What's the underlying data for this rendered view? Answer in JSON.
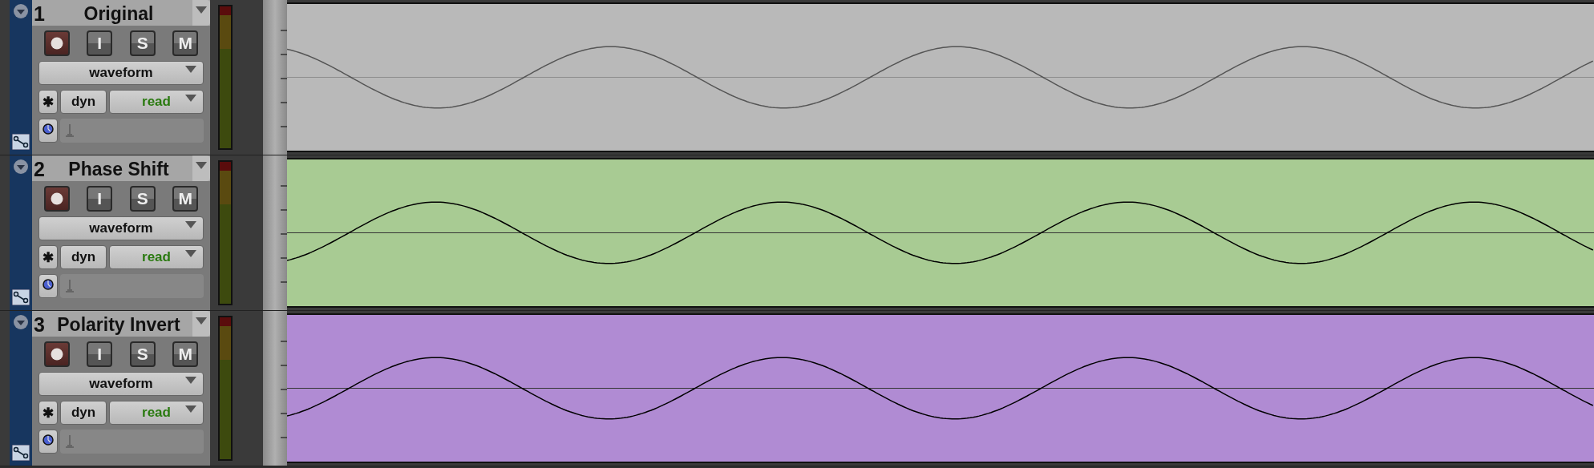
{
  "tracks": [
    {
      "number": "1",
      "name": "Original",
      "color": "#b9b9b9",
      "kind": "normal",
      "buttons": [
        "I",
        "S",
        "M"
      ],
      "view": "waveform",
      "asterisk": "✱",
      "dyn": "dyn",
      "automation": "read"
    },
    {
      "number": "2",
      "name": "Phase Shift",
      "color": "#a8cb93",
      "kind": "flipped",
      "buttons": [
        "I",
        "S",
        "M"
      ],
      "view": "waveform",
      "asterisk": "✱",
      "dyn": "dyn",
      "automation": "read"
    },
    {
      "number": "3",
      "name": "Polarity Invert",
      "color": "#b08bd3",
      "kind": "flipped",
      "buttons": [
        "I",
        "S",
        "M"
      ],
      "view": "waveform",
      "asterisk": "✱",
      "dyn": "dyn",
      "automation": "read"
    }
  ]
}
